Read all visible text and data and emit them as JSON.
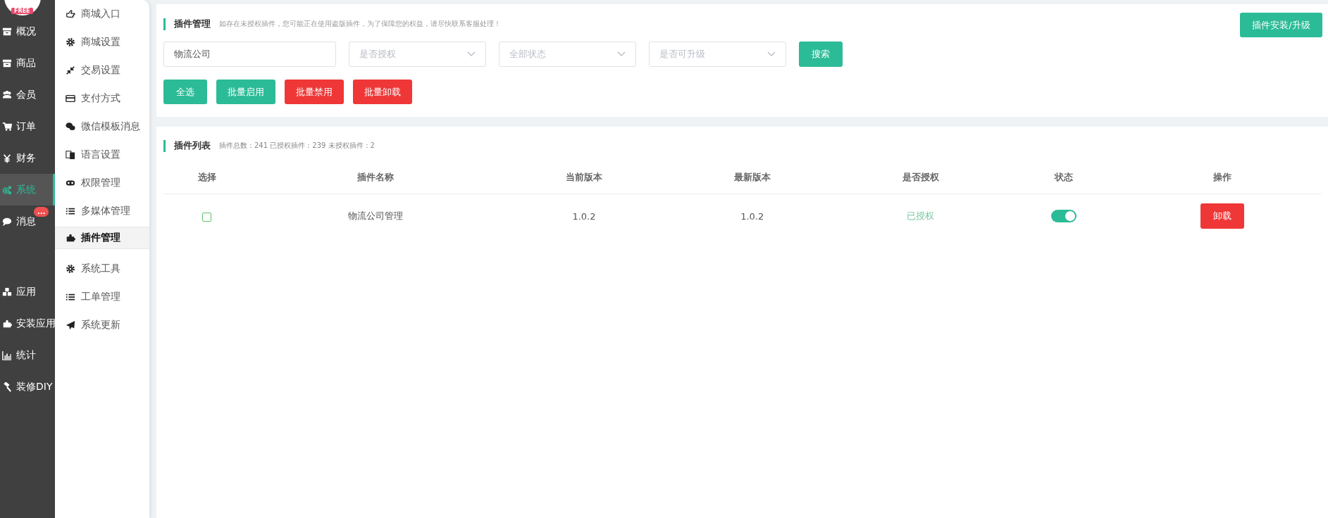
{
  "logo": {
    "badge": "FREE"
  },
  "nav": [
    {
      "label": "概况",
      "selected": false
    },
    {
      "label": "商品",
      "selected": false
    },
    {
      "label": "会员",
      "selected": false
    },
    {
      "label": "订单",
      "selected": false
    },
    {
      "label": "财务",
      "selected": false
    },
    {
      "label": "系统",
      "selected": true
    },
    {
      "label": "消息",
      "selected": false,
      "badge": "..."
    },
    {
      "label": "应用",
      "selected": false
    },
    {
      "label": "安装应用",
      "selected": false
    },
    {
      "label": "统计",
      "selected": false
    },
    {
      "label": "装修DIY",
      "selected": false
    }
  ],
  "submenu": [
    {
      "label": "商城入口",
      "selected": false
    },
    {
      "label": "商城设置",
      "selected": false
    },
    {
      "label": "交易设置",
      "selected": false
    },
    {
      "label": "支付方式",
      "selected": false
    },
    {
      "label": "微信模板消息",
      "selected": false
    },
    {
      "label": "语言设置",
      "selected": false
    },
    {
      "label": "权限管理",
      "selected": false
    },
    {
      "label": "多媒体管理",
      "selected": false
    },
    {
      "label": "插件管理",
      "selected": true
    },
    {
      "label": "系统工具",
      "selected": false
    },
    {
      "label": "工单管理",
      "selected": false
    },
    {
      "label": "系统更新",
      "selected": false
    }
  ],
  "header": {
    "title": "插件管理",
    "notice": "如存在未授权插件，您可能正在使用盗版插件，为了保障您的权益，请尽快联系客服处理！",
    "install_button": "插件安装/升级"
  },
  "filters": {
    "search_value": "物流公司",
    "selects": [
      {
        "placeholder": "是否授权"
      },
      {
        "placeholder": "全部状态"
      },
      {
        "placeholder": "是否可升级"
      }
    ],
    "search_button": "搜索"
  },
  "actions": [
    {
      "label": "全选",
      "kind": "primary"
    },
    {
      "label": "批量启用",
      "kind": "primary"
    },
    {
      "label": "批量禁用",
      "kind": "danger"
    },
    {
      "label": "批量卸载",
      "kind": "danger"
    }
  ],
  "list": {
    "title": "插件列表",
    "summary": "插件总数：241 已授权插件：239 未授权插件：2",
    "columns": [
      "选择",
      "插件名称",
      "当前版本",
      "最新版本",
      "是否授权",
      "状态",
      "操作"
    ],
    "rows": [
      {
        "checked": false,
        "name": "物流公司管理",
        "current_version": "1.0.2",
        "latest_version": "1.0.2",
        "authorized": "已授权",
        "enabled": true,
        "action": "卸载"
      }
    ]
  }
}
